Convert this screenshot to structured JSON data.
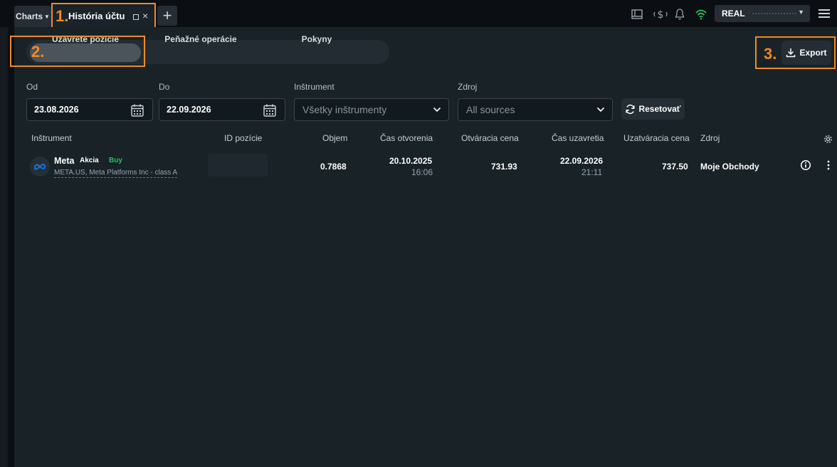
{
  "topbar": {
    "charts_label": "Charts",
    "active_tab": {
      "number": "1.",
      "title": "História účtu"
    },
    "account_label": "REAL"
  },
  "segments": {
    "number": "2.",
    "items": [
      {
        "label": "Uzavreté pozície",
        "active": true
      },
      {
        "label": "Peňažné operácie",
        "active": false
      },
      {
        "label": "Pokyny",
        "active": false
      }
    ]
  },
  "export": {
    "number": "3.",
    "label": "Export"
  },
  "filters": {
    "from": {
      "label": "Od",
      "value": "23.08.2026"
    },
    "to": {
      "label": "Do",
      "value": "22.09.2026"
    },
    "instrument": {
      "label": "Inštrument",
      "value": "Všetky inštrumenty"
    },
    "source": {
      "label": "Zdroj",
      "value": "All sources"
    },
    "reset_label": "Resetovať"
  },
  "table": {
    "columns": [
      "Inštrument",
      "ID pozície",
      "Objem",
      "Čas otvorenia",
      "Otváracia cena",
      "Čas uzavretia",
      "Uzatváracia cena",
      "Zdroj"
    ],
    "rows": [
      {
        "instrument_name": "Meta",
        "instrument_type": "Akcia",
        "direction": "Buy",
        "instrument_sub": "META.US, Meta Platforms Inc - class A",
        "volume": "0.7868",
        "open_date": "20.10.2025",
        "open_time": "16:06",
        "open_price": "731.93",
        "close_date": "22.09.2026",
        "close_time": "21:11",
        "close_price": "737.50",
        "source": "Moje Obchody"
      }
    ]
  },
  "colors": {
    "accent": "#f08a24",
    "buy": "#22c55e",
    "panel": "#192227"
  }
}
